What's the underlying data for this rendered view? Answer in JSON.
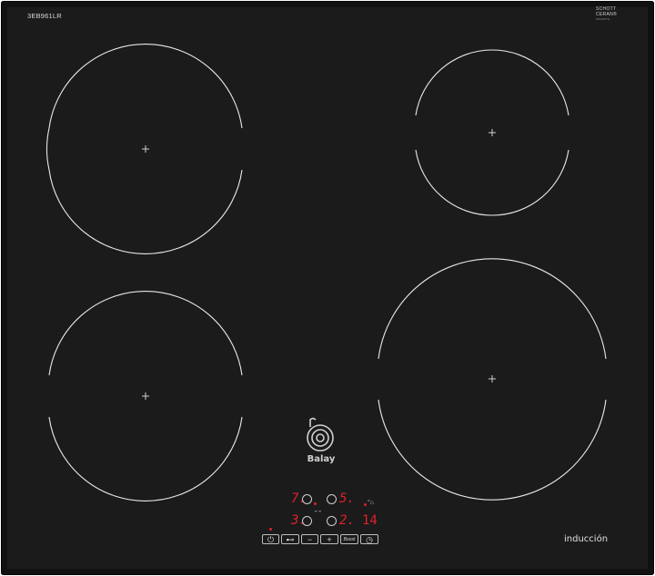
{
  "hob": {
    "model": "3EB961LR",
    "glass_brand_line1": "SCHOTT",
    "glass_brand_line2": "CERAN®",
    "glass_serial": "M4002TG",
    "brand": "Balay",
    "type_label": "inducción"
  },
  "display": {
    "zone_front_left": "3.",
    "zone_rear_left": "7.",
    "zone_rear_right": "5.",
    "zone_front_right": "2.",
    "timer": "14",
    "timer_symbol": "°⌂",
    "combine_label": "⇤⇥"
  },
  "controls": {
    "power_label": "⏻",
    "lock_label": "⊷",
    "minus_label": "−",
    "plus_label": "+",
    "boost_label": "Boost",
    "timer_label": "◷"
  },
  "colors": {
    "glass": "#1b1b1b",
    "lines": "#e8e8e8",
    "display_red": "#e0202a"
  }
}
